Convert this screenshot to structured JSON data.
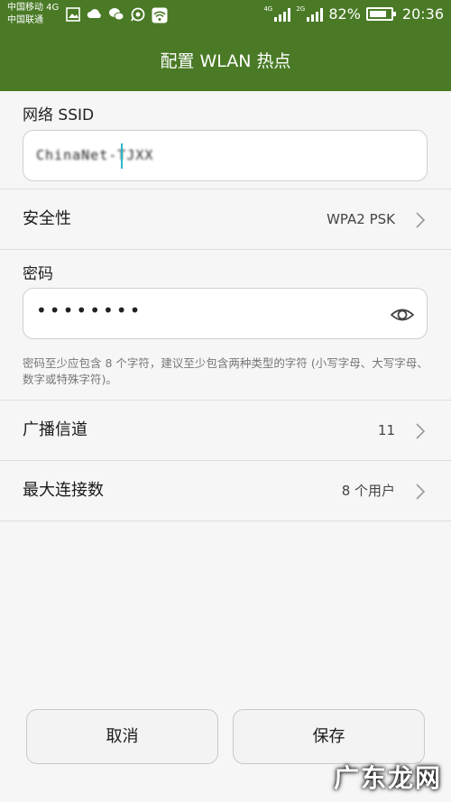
{
  "status_bar": {
    "carrier_1": "中国移动 4G",
    "carrier_2": "中国联通",
    "icons": [
      "image-icon",
      "cloud-icon",
      "wechat-icon",
      "chat-icon",
      "wifi-hotspot-icon"
    ],
    "sim1_network": "4G",
    "sim2_network": "2G",
    "battery_percent_text": "82%",
    "battery_level": 0.82,
    "time": "20:36"
  },
  "header": {
    "title": "配置 WLAN 热点"
  },
  "ssid": {
    "label": "网络 SSID",
    "value": "ChinaNet-TJXX"
  },
  "security": {
    "label": "安全性",
    "value": "WPA2 PSK"
  },
  "password": {
    "label": "密码",
    "value": "••••••••",
    "hint": "密码至少应包含 8 个字符，建议至少包含两种类型的字符 (小写字母、大写字母、数字或特殊字符)。"
  },
  "channel": {
    "label": "广播信道",
    "value": "11"
  },
  "max_connections": {
    "label": "最大连接数",
    "value": "8 个用户"
  },
  "buttons": {
    "cancel": "取消",
    "save": "保存"
  },
  "watermark": "广东龙网",
  "colors": {
    "header_bg": "#4a7a26",
    "cursor": "#2ab5c8"
  }
}
